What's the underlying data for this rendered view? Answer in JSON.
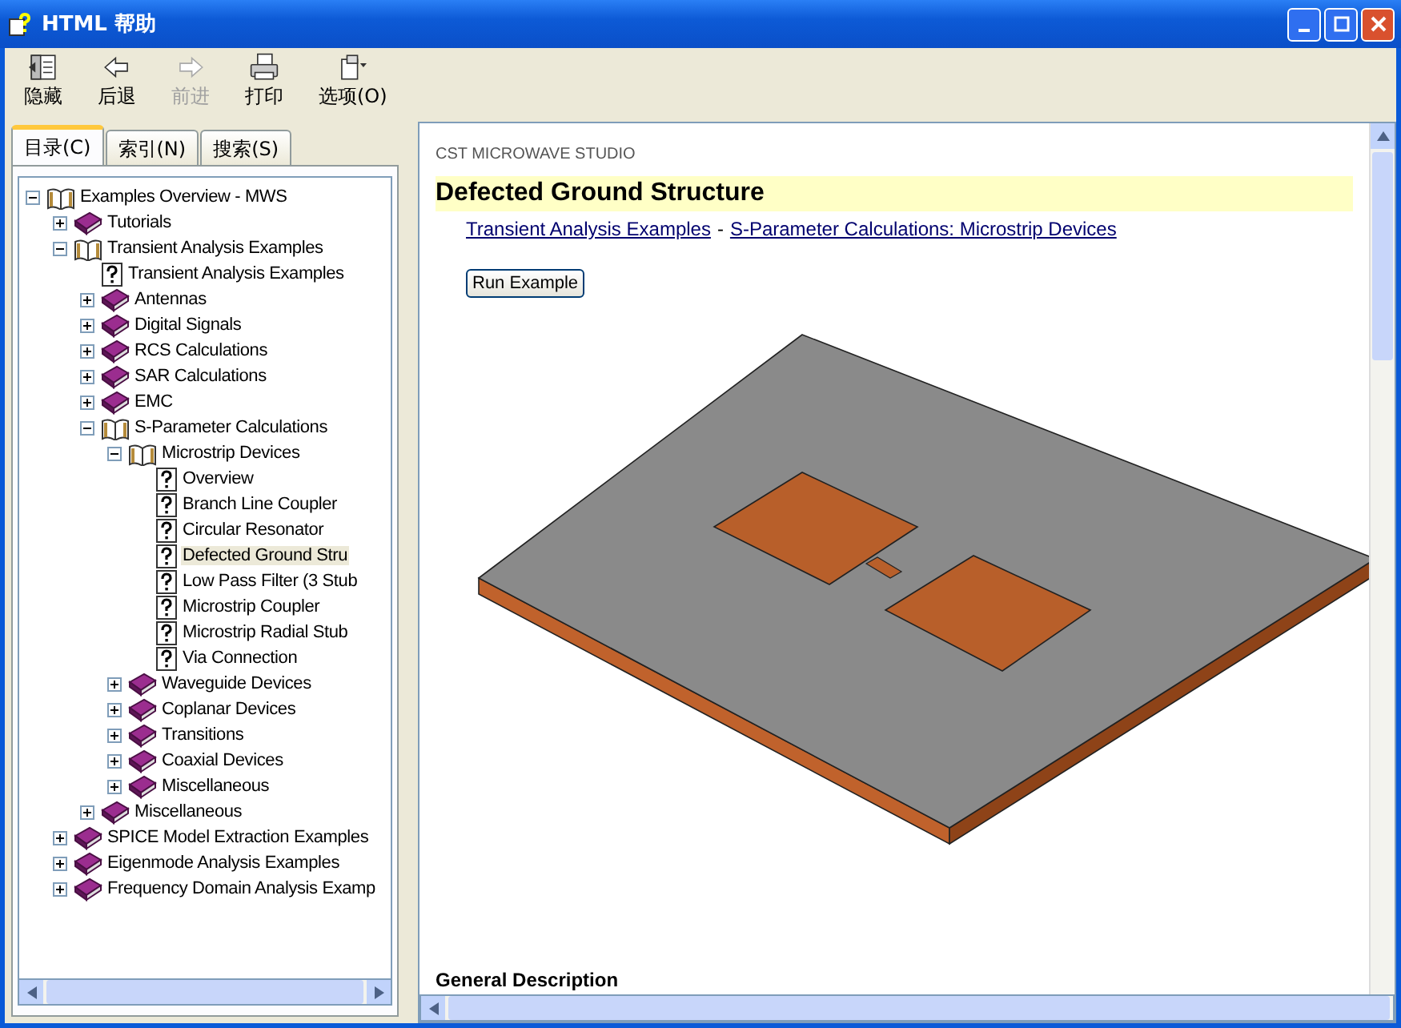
{
  "window": {
    "title": "HTML  帮助"
  },
  "toolbar": [
    {
      "label": "隐藏",
      "kind": "hide",
      "disabled": false
    },
    {
      "label": "后退",
      "kind": "back",
      "disabled": false
    },
    {
      "label": "前进",
      "kind": "forward",
      "disabled": true
    },
    {
      "label": "打印",
      "kind": "print",
      "disabled": false
    },
    {
      "label": "选项(O)",
      "kind": "options",
      "disabled": false
    }
  ],
  "tabs": [
    {
      "label": "目录(C)",
      "selected": true
    },
    {
      "label": "索引(N)",
      "selected": false
    },
    {
      "label": "搜索(S)",
      "selected": false
    }
  ],
  "tree": [
    {
      "label": "Examples Overview - MWS",
      "kind": "book",
      "expanded": true,
      "selected": false,
      "children": [
        {
          "label": "Tutorials",
          "kind": "book",
          "expanded": false,
          "selected": false
        },
        {
          "label": "Transient Analysis Examples",
          "kind": "book",
          "expanded": true,
          "selected": false,
          "children": [
            {
              "label": "Transient Analysis Examples",
              "kind": "page",
              "selected": false
            },
            {
              "label": "Antennas",
              "kind": "book",
              "expanded": false,
              "selected": false
            },
            {
              "label": "Digital Signals",
              "kind": "book",
              "expanded": false,
              "selected": false
            },
            {
              "label": "RCS Calculations",
              "kind": "book",
              "expanded": false,
              "selected": false
            },
            {
              "label": "SAR Calculations",
              "kind": "book",
              "expanded": false,
              "selected": false
            },
            {
              "label": "EMC",
              "kind": "book",
              "expanded": false,
              "selected": false
            },
            {
              "label": "S-Parameter Calculations",
              "kind": "book",
              "expanded": true,
              "selected": false,
              "children": [
                {
                  "label": "Microstrip Devices",
                  "kind": "book",
                  "expanded": true,
                  "selected": false,
                  "children": [
                    {
                      "label": "Overview",
                      "kind": "page",
                      "selected": false
                    },
                    {
                      "label": "Branch Line Coupler",
                      "kind": "page",
                      "selected": false
                    },
                    {
                      "label": "Circular Resonator",
                      "kind": "page",
                      "selected": false
                    },
                    {
                      "label": "Defected Ground Stru",
                      "kind": "page",
                      "selected": true
                    },
                    {
                      "label": "Low Pass Filter (3 Stub",
                      "kind": "page",
                      "selected": false
                    },
                    {
                      "label": "Microstrip Coupler",
                      "kind": "page",
                      "selected": false
                    },
                    {
                      "label": "Microstrip Radial Stub",
                      "kind": "page",
                      "selected": false
                    },
                    {
                      "label": "Via Connection",
                      "kind": "page",
                      "selected": false
                    }
                  ]
                },
                {
                  "label": "Waveguide Devices",
                  "kind": "book",
                  "expanded": false,
                  "selected": false
                },
                {
                  "label": "Coplanar Devices",
                  "kind": "book",
                  "expanded": false,
                  "selected": false
                },
                {
                  "label": "Transitions",
                  "kind": "book",
                  "expanded": false,
                  "selected": false
                },
                {
                  "label": "Coaxial Devices",
                  "kind": "book",
                  "expanded": false,
                  "selected": false
                },
                {
                  "label": "Miscellaneous",
                  "kind": "book",
                  "expanded": false,
                  "selected": false
                }
              ]
            },
            {
              "label": "Miscellaneous",
              "kind": "book",
              "expanded": false,
              "selected": false
            }
          ]
        },
        {
          "label": "SPICE Model Extraction Examples",
          "kind": "book",
          "expanded": false,
          "selected": false
        },
        {
          "label": "Eigenmode Analysis Examples",
          "kind": "book",
          "expanded": false,
          "selected": false
        },
        {
          "label": "Frequency Domain Analysis Examp",
          "kind": "book",
          "expanded": false,
          "selected": false
        }
      ]
    }
  ],
  "content": {
    "product": "CST MICROWAVE STUDIO",
    "heading": "Defected Ground Structure",
    "breadcrumbs": [
      "Transient Analysis Examples",
      "S-Parameter Calculations: Microstrip Devices"
    ],
    "separator": "-",
    "run_button": "Run Example",
    "section": "General Description"
  }
}
